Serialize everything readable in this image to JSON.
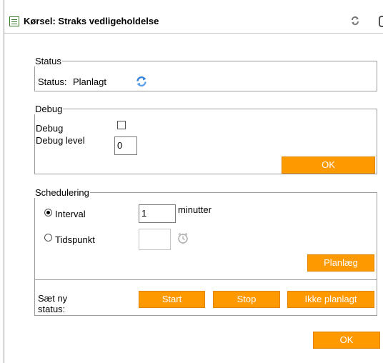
{
  "window": {
    "title": "Kørsel: Straks vedligeholdelse"
  },
  "status_section": {
    "legend": "Status",
    "status_label": "Status:",
    "status_value": "Planlagt"
  },
  "debug_section": {
    "legend": "Debug",
    "debug_label": "Debug",
    "debug_checked": false,
    "debug_level_label": "Debug level",
    "debug_level_value": "0",
    "ok_label": "OK"
  },
  "schedule_section": {
    "legend": "Schedulering",
    "interval_label": "Interval",
    "interval_selected": true,
    "interval_value": "1",
    "interval_unit": "minutter",
    "time_label": "Tidspunkt",
    "time_selected": false,
    "time_value": "",
    "plan_button_label": "Planlæg",
    "new_status_label_line1": "Sæt ny",
    "new_status_label_line2": "status:",
    "start_label": "Start",
    "stop_label": "Stop",
    "unschedule_label": "Ikke planlagt"
  },
  "footer": {
    "ok_label": "OK"
  },
  "colors": {
    "button_bg": "#ff9900",
    "border": "#9c9c9c",
    "icon_blue": "#2f7fd8"
  },
  "icons": [
    "window-icon",
    "refresh-icon",
    "status-refresh-icon",
    "clock-icon"
  ]
}
